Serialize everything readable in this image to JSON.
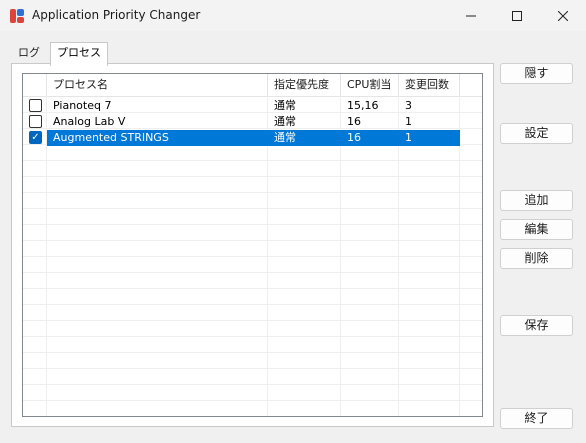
{
  "window": {
    "title": "Application Priority Changer"
  },
  "tabs": [
    {
      "label": "ログ"
    },
    {
      "label": "プロセス"
    }
  ],
  "columns": [
    "プロセス名",
    "指定優先度",
    "CPU割当",
    "変更回数"
  ],
  "rows": [
    {
      "checked": false,
      "name": "Pianoteq 7",
      "priority": "通常",
      "cpu": "15,16",
      "count": "3"
    },
    {
      "checked": false,
      "name": "Analog Lab V",
      "priority": "通常",
      "cpu": "16",
      "count": "1"
    },
    {
      "checked": true,
      "name": "Augmented STRINGS",
      "priority": "通常",
      "cpu": "16",
      "count": "1"
    }
  ],
  "buttons": {
    "hide": "隠す",
    "settings": "設定",
    "add": "追加",
    "edit": "編集",
    "delete": "削除",
    "save": "保存",
    "exit": "終了"
  },
  "colors": {
    "selection": "#0078d7",
    "accent": "#0067c0"
  }
}
